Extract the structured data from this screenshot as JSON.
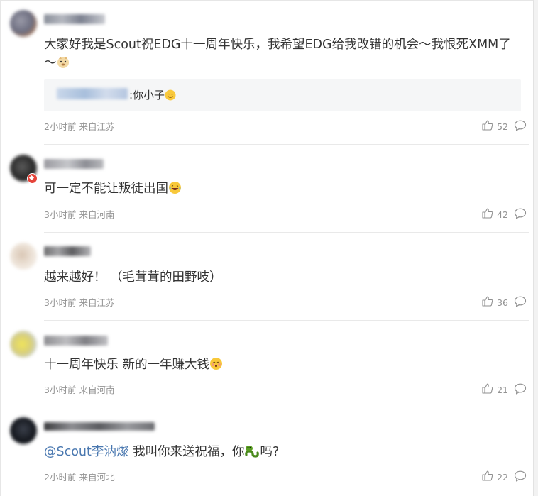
{
  "comments": [
    {
      "text": "大家好我是Scout祝EDG十一周年快乐，我希望EDG给我改错的机会～我恨死XMM了～",
      "quote_text": ":你小子",
      "time": "2小时前",
      "location": "来自江苏",
      "likes": "52",
      "emoji": [
        "doge-emoji",
        "smile-emoji"
      ]
    },
    {
      "text": "可一定不能让叛徒出国",
      "time": "3小时前",
      "location": "来自河南",
      "likes": "42",
      "emoji": [
        "laugh-cry-emoji"
      ]
    },
    {
      "text": "越来越好！ （毛茸茸的田野吱）",
      "time": "3小时前",
      "location": "来自江苏",
      "likes": "36"
    },
    {
      "text": "十一周年快乐 新的一年赚大钱",
      "time": "3小时前",
      "location": "来自河南",
      "likes": "21",
      "emoji": [
        "shy-emoji"
      ]
    },
    {
      "mention": "@Scout李汭燦",
      "text": " 我叫你来送祝福，你",
      "text_after": "吗?",
      "time": "2小时前",
      "location": "来自河北",
      "likes": "22",
      "emoji": [
        "snake-emoji"
      ]
    }
  ],
  "icons": {
    "like": "thumbs-up-icon",
    "reply": "comment-bubble-icon"
  },
  "colors": {
    "text": "#333333",
    "meta": "#939393",
    "mention": "#4a78b0",
    "quote_bg": "#f5f6f7",
    "divider": "#e9e9e9"
  }
}
